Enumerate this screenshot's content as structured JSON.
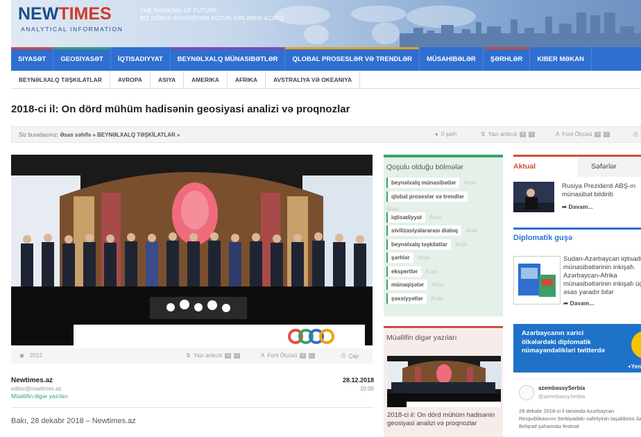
{
  "header": {
    "logo_new": "NEW",
    "logo_times": "TIMES",
    "logo_sub": "ANALYTICAL INFORMATION",
    "tagline_1": "The thinking of future",
    "tagline_2": "Biz dünya siyasətinin bütün sirlərini açırıq"
  },
  "nav": {
    "items": [
      {
        "label": "Siyasət",
        "color": "#d04a3b"
      },
      {
        "label": "Geosiyasət",
        "color": "#3aa06a"
      },
      {
        "label": "İqtisadiyyat",
        "color": "#2f6fd0"
      },
      {
        "label": "Beynəlxalq münasibətlər",
        "color": "#8e44ad"
      },
      {
        "label": "Qlobal proseslər və trendlər",
        "color": "#f0a202"
      },
      {
        "label": "Müsahibələr",
        "color": "#2f6fd0"
      },
      {
        "label": "Şərhlər",
        "color": "#d04a3b"
      },
      {
        "label": "Kiber məkan",
        "color": "#2f6fd0"
      }
    ]
  },
  "subnav": {
    "items": [
      "Beynəlxalq təşkilatlar",
      "Avropa",
      "Asiya",
      "Amerika",
      "Afrika",
      "Avstraliya və Okeaniya"
    ]
  },
  "article": {
    "title": "2018-ci il: On dörd mühüm hadisənin geosiyasi analizi və proqnozlar",
    "breadcrumb_prefix": "Siz buradasınız:",
    "breadcrumb_path": "Əsas səhifə » BEYNƏLXALQ TƏŞKİLATLAR »",
    "comments": "0 şərh",
    "font_size_top": "Yazı ardıcılı",
    "font_size_label": "Font Ölçüsü",
    "views": "2012",
    "font_size_bottom": "Yazı ardıcılı",
    "print": "Çap",
    "author_name": "Newtimes.az",
    "author_email": "editor@newtimes.az",
    "author_link": "Müəllifin digər yazıları",
    "date": "28.12.2018",
    "time": "10:00",
    "dateline": "Bakı, 28 dekabr 2018 – Newtimes.az"
  },
  "categories": {
    "header": "Qoşulu olduğu bölmələr",
    "archive_label": "Arxiv",
    "items": [
      "beynəlxalq münasibətlər",
      "qlobal proseslər və trendlər",
      "iqtisadiyyat",
      "sivilizasiyalararası dialoq",
      "beynəlxalq təşkilatlar",
      "şərhlər",
      "ekspertlər",
      "münaqişələr",
      "şəxsiyyətlər"
    ]
  },
  "author_box": {
    "header": "Müəllifin digər yazıları",
    "caption": "2018-ci il: On dörd mühüm hadisənin geosiyasi analizi və proqnozlar"
  },
  "sidebar": {
    "tab_active": "Aktual",
    "tab_other": "Səfərlər",
    "news1_text": "Rusiya Prezidenti ABŞ-ın münasibət bildirib",
    "more": "Davam...",
    "diplomatic_header": "Diplomatik guşə",
    "diplomatic_text": "Sudan-Azərbaycan iqtisadi münasibətlərinin inkişafı. Azərbaycan-Afrika münasibətlərinin inkişafı üçün əsas yaradır bilər",
    "twitter_text_1": "Azərbaycanın xarici",
    "twitter_text_2": "ölkələrdəki diplomatik",
    "twitter_text_3": "nümayəndəlikləri twitterdə",
    "twitter_more": "+Yen",
    "tweet_name": "azembassySerbia",
    "tweet_handle": "@azembassySerbia",
    "tweet_body": "28 dekabr 2018-ci il tarixində Azərbaycan Respublikasının Serbiyadakı səfirliyinin təşəbbüsü ilə Belqrad şəhərində festival"
  }
}
